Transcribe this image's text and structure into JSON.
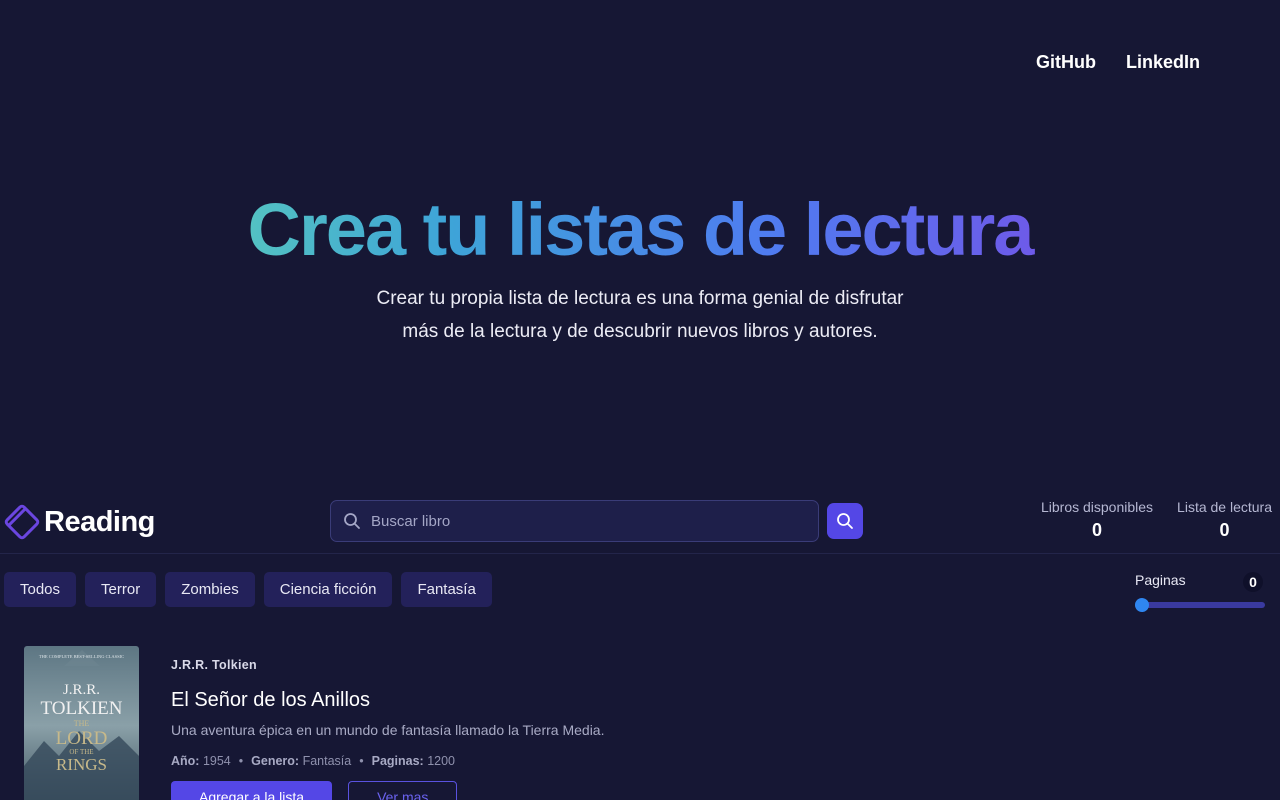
{
  "nav": {
    "github": "GitHub",
    "linkedin": "LinkedIn"
  },
  "hero": {
    "title": "Crea tu listas de lectura",
    "subtitle_line1": "Crear tu propia lista de lectura es una forma genial de disfrutar",
    "subtitle_line2": "más de la lectura y de descubrir nuevos libros y autores."
  },
  "brand": {
    "name": "Reading",
    "icon": "book-icon",
    "accent": "#5447e6"
  },
  "search": {
    "placeholder": "Buscar libro",
    "value": "",
    "icon": "search-icon"
  },
  "stats": {
    "available_label": "Libros disponibles",
    "available_value": "0",
    "reading_list_label": "Lista de lectura",
    "reading_list_value": "0"
  },
  "filters": [
    "Todos",
    "Terror",
    "Zombies",
    "Ciencia ficción",
    "Fantasía"
  ],
  "pages_filter": {
    "label": "Paginas",
    "value": "0",
    "level_fraction": 0
  },
  "book": {
    "author": "J.R.R. Tolkien",
    "title": "El Señor de los Anillos",
    "description": "Una aventura épica en un mundo de fantasía llamado la Tierra Media.",
    "year_label": "Año:",
    "year": "1954",
    "genre_label": "Genero:",
    "genre": "Fantasía",
    "pages_label": "Paginas:",
    "pages": "1200",
    "add_button": "Agregar a la lista",
    "more_button": "Ver mas",
    "cover": {
      "top_text": "THE COMPLETE BEST-SELLING CLASSIC",
      "author_line1": "J.R.R.",
      "author_line2": "TOLKIEN",
      "title_line1": "THE",
      "title_line2": "LORD",
      "title_line3": "OF THE",
      "title_line4": "RINGS"
    }
  }
}
